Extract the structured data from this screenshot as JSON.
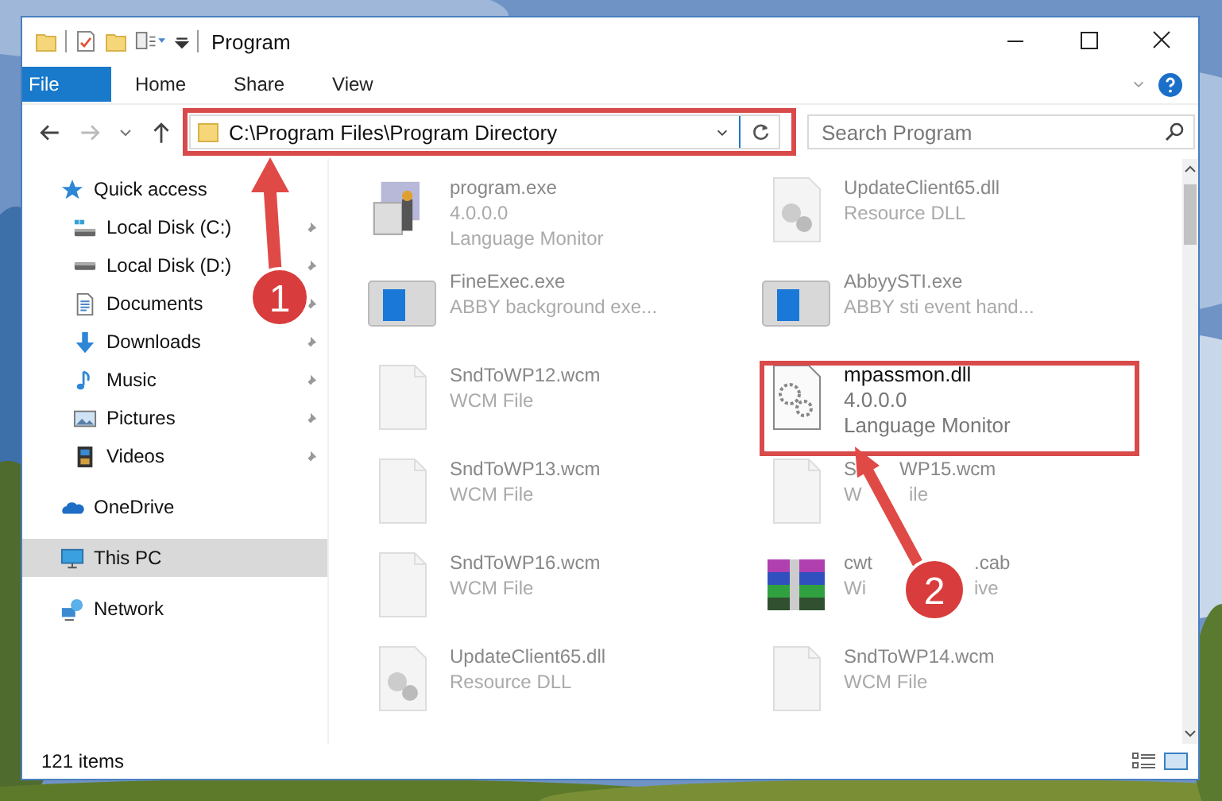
{
  "window": {
    "title": "Program"
  },
  "ribbon_tabs": [
    {
      "label": "File",
      "kind": "file"
    },
    {
      "label": "Home",
      "kind": "tab"
    },
    {
      "label": "Share",
      "kind": "tab"
    },
    {
      "label": "View",
      "kind": "tab"
    }
  ],
  "address": {
    "path": "C:\\Program Files\\Program Directory"
  },
  "search": {
    "placeholder": "Search Program"
  },
  "nav": [
    {
      "label": "Quick access",
      "kind": "star",
      "selected": false,
      "children": [
        {
          "label": "Local Disk (C:)",
          "kind": "system-drive",
          "pinned": true
        },
        {
          "label": "Local Disk (D:)",
          "kind": "drive",
          "pinned": true
        },
        {
          "label": "Documents",
          "kind": "documents",
          "pinned": true
        },
        {
          "label": "Downloads",
          "kind": "downloads",
          "pinned": true
        },
        {
          "label": "Music",
          "kind": "music",
          "pinned": true
        },
        {
          "label": "Pictures",
          "kind": "pictures",
          "pinned": true
        },
        {
          "label": "Videos",
          "kind": "videos",
          "pinned": true
        }
      ]
    },
    {
      "label": "OneDrive",
      "kind": "cloud",
      "selected": false
    },
    {
      "label": "This PC",
      "kind": "computer",
      "selected": true
    },
    {
      "label": "Network",
      "kind": "network",
      "selected": false
    }
  ],
  "files": [
    {
      "name": "program.exe",
      "details": [
        "4.0.0.0",
        "Language Monitor"
      ],
      "kind": "installer",
      "highlighted": false
    },
    {
      "name": "UpdateClient65.dll",
      "details": [
        "Resource DLL"
      ],
      "kind": "library",
      "highlighted": false
    },
    {
      "name": "FineExec.exe",
      "details": [
        "ABBY background exe..."
      ],
      "kind": "application",
      "highlighted": false
    },
    {
      "name": "AbbyySTI.exe",
      "details": [
        "ABBY sti event hand..."
      ],
      "kind": "application",
      "highlighted": false
    },
    {
      "name": "SndToWP12.wcm",
      "details": [
        "WCM File"
      ],
      "kind": "blank",
      "highlighted": false
    },
    {
      "name": "mpassmon.dll",
      "details": [
        "4.0.0.0",
        "Language Monitor"
      ],
      "kind": "settings",
      "highlighted": true
    },
    {
      "name": "SndToWP13.wcm",
      "details": [
        "WCM File"
      ],
      "kind": "blank",
      "highlighted": false
    },
    {
      "name_parts": [
        "S",
        "WP15.wcm"
      ],
      "details_parts": [
        "W",
        "ile"
      ],
      "kind": "blank",
      "highlighted": false
    },
    {
      "name": "SndToWP16.wcm",
      "details": [
        "WCM File"
      ],
      "kind": "blank",
      "highlighted": false
    },
    {
      "name_parts": [
        "cwt",
        ".cab"
      ],
      "details_parts": [
        "Wi",
        "ive"
      ],
      "kind": "archive",
      "highlighted": false
    },
    {
      "name": "UpdateClient65.dll",
      "details": [
        "Resource DLL"
      ],
      "kind": "library",
      "highlighted": false
    },
    {
      "name": "SndToWP14.wcm",
      "details": [
        "WCM File"
      ],
      "kind": "blank",
      "highlighted": false
    }
  ],
  "status_bar": {
    "count": "121 items"
  },
  "annotations": [
    {
      "number": "1"
    },
    {
      "number": "2"
    }
  ]
}
